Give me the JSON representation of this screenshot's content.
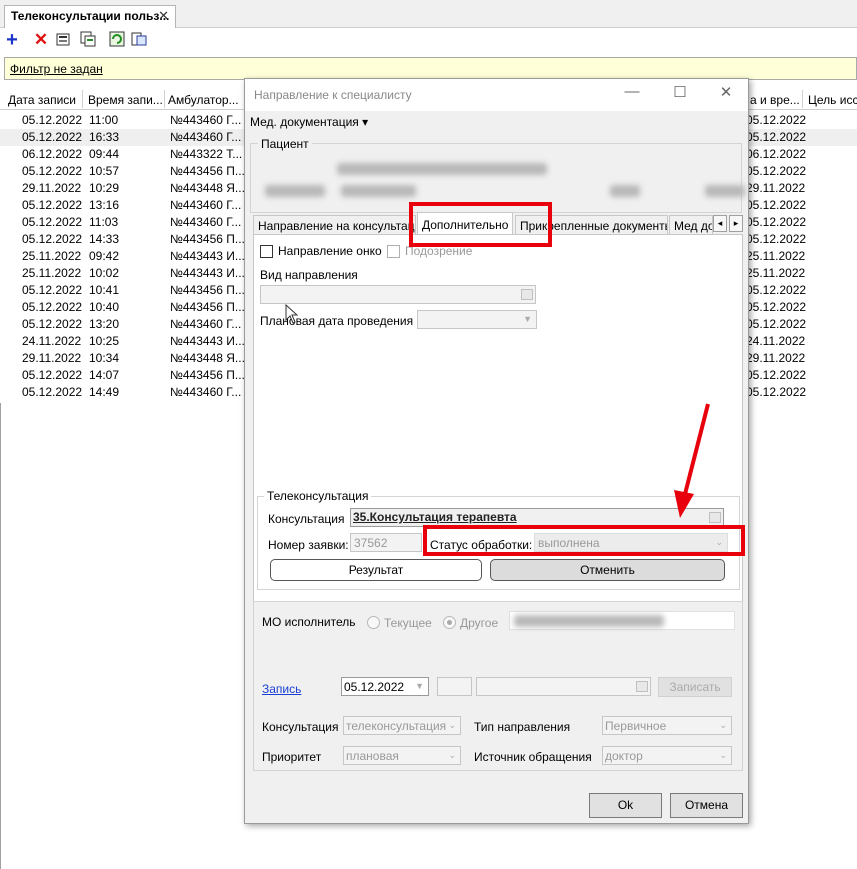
{
  "main_tab": {
    "label": "Телеконсультации польз...",
    "close": "✕"
  },
  "toolbar": {
    "icons": [
      "plus-icon",
      "delete-icon",
      "edit-icon",
      "copy-icon",
      "refresh-icon",
      "export-icon"
    ]
  },
  "filter": {
    "label": "Фильтр не задан"
  },
  "grid": {
    "headers": [
      "Дата записи",
      "Время запи...",
      "Амбулатор...",
      "а и вре...",
      "Цель исс"
    ],
    "rows": [
      {
        "date": "05.12.2022",
        "time": "11:00",
        "amb": "№443460 Г...",
        "right": "05.12.2022"
      },
      {
        "date": "05.12.2022",
        "time": "16:33",
        "amb": "№443460 Г...",
        "right": "05.12.2022"
      },
      {
        "date": "06.12.2022",
        "time": "09:44",
        "amb": "№443322 Т...",
        "right": "06.12.2022"
      },
      {
        "date": "05.12.2022",
        "time": "10:57",
        "amb": "№443456 П...",
        "right": "05.12.2022"
      },
      {
        "date": "29.11.2022",
        "time": "10:29",
        "amb": "№443448 Я...",
        "right": "29.11.2022"
      },
      {
        "date": "05.12.2022",
        "time": "13:16",
        "amb": "№443460 Г...",
        "right": "05.12.2022"
      },
      {
        "date": "05.12.2022",
        "time": "11:03",
        "amb": "№443460 Г...",
        "right": "05.12.2022"
      },
      {
        "date": "05.12.2022",
        "time": "14:33",
        "amb": "№443456 П...",
        "right": "05.12.2022"
      },
      {
        "date": "25.11.2022",
        "time": "09:42",
        "amb": "№443443 И...",
        "right": "25.11.2022"
      },
      {
        "date": "25.11.2022",
        "time": "10:02",
        "amb": "№443443 И...",
        "right": "25.11.2022"
      },
      {
        "date": "05.12.2022",
        "time": "10:41",
        "amb": "№443456 П...",
        "right": "05.12.2022"
      },
      {
        "date": "05.12.2022",
        "time": "10:40",
        "amb": "№443456 П...",
        "right": "05.12.2022"
      },
      {
        "date": "05.12.2022",
        "time": "13:20",
        "amb": "№443460 Г...",
        "right": "05.12.2022"
      },
      {
        "date": "24.11.2022",
        "time": "10:25",
        "amb": "№443443 И...",
        "right": "24.11.2022"
      },
      {
        "date": "29.11.2022",
        "time": "10:34",
        "amb": "№443448 Я...",
        "right": "29.11.2022"
      },
      {
        "date": "05.12.2022",
        "time": "14:07",
        "amb": "№443456 П...",
        "right": "05.12.2022"
      },
      {
        "date": "05.12.2022",
        "time": "14:49",
        "amb": "№443460 Г...",
        "right": "05.12.2022"
      }
    ]
  },
  "dialog": {
    "title": "Направление к специалисту",
    "med_menu": "Мед. документация ▾",
    "patient_group": "Пациент",
    "tabs": [
      "Направление на консультацию",
      "Дополнительно",
      "Прикрепленные документы",
      "Мед док"
    ],
    "chk_onco": "Направление онко",
    "chk_suspect": "Подозрение",
    "vid_label": "Вид направления",
    "plan_date_label": "Плановая дата проведения",
    "tele_group": "Телеконсультация",
    "consult_label": "Консультация",
    "consult_value": "35.Консультация терапевта",
    "req_num_label": "Номер заявки:",
    "req_num_value": "37562",
    "status_label": "Статус обработки:",
    "status_value": "выполнена",
    "result_btn": "Результат",
    "cancel_tele_btn": "Отменить",
    "mo_label": "МО исполнитель",
    "radio_current": "Текущее",
    "radio_other": "Другое",
    "zapis_link": "Запись",
    "zapis_date": "05.12.2022",
    "zapisat_btn": "Записать",
    "konsult_label": "Консультация",
    "konsult_value": "телеконсультация",
    "tip_label": "Тип направления",
    "tip_value": "Первичное",
    "priority_label": "Приоритет",
    "priority_value": "плановая",
    "source_label": "Источник обращения",
    "source_value": "доктор",
    "ok_btn": "Ok",
    "cancel_btn": "Отмена"
  },
  "colors": {
    "highlight": "#e8000d",
    "filter_bg": "#ffffd8"
  }
}
